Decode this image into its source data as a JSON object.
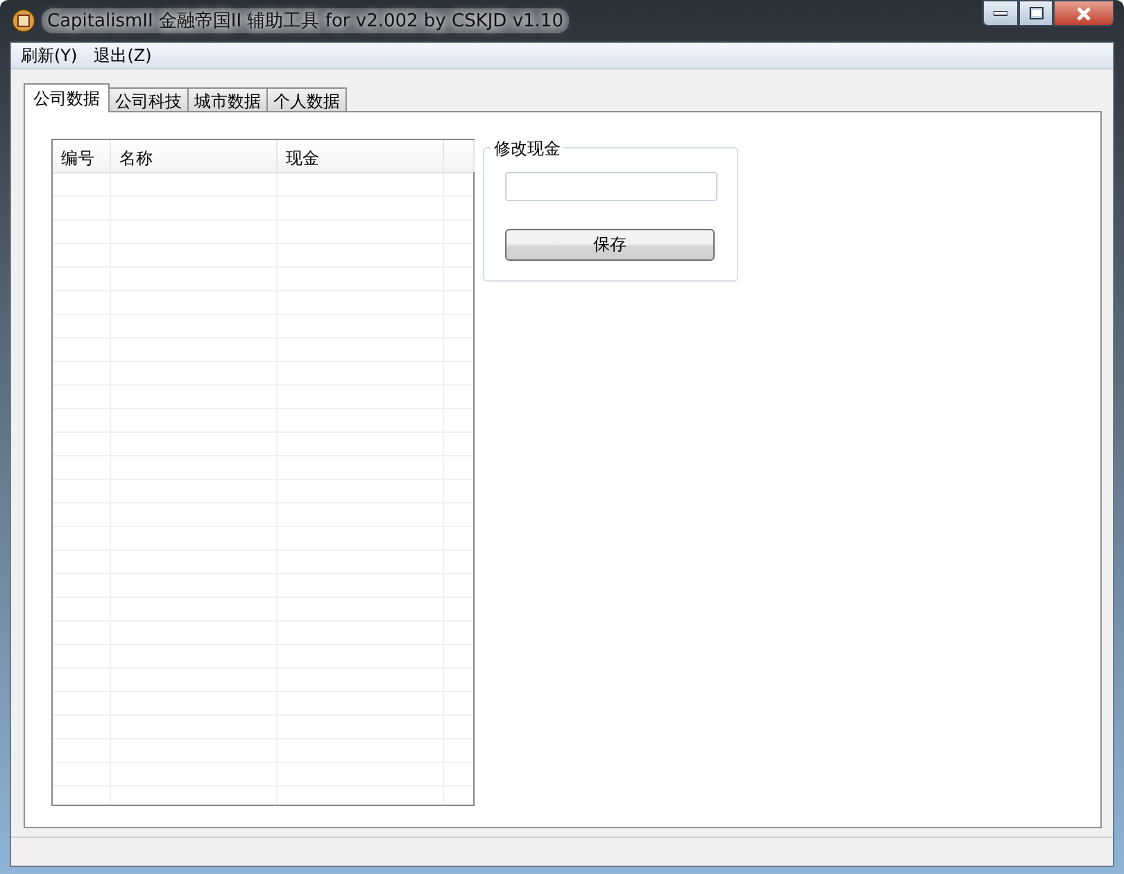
{
  "window": {
    "title": "CapitalismII 金融帝国II 辅助工具 for v2.002 by CSKJD v1.10"
  },
  "menu": [
    {
      "label": "刷新(Y)"
    },
    {
      "label": "退出(Z)"
    }
  ],
  "tabs": [
    {
      "label": "公司数据",
      "selected": true
    },
    {
      "label": "公司科技",
      "selected": false
    },
    {
      "label": "城市数据",
      "selected": false
    },
    {
      "label": "个人数据",
      "selected": false
    }
  ],
  "table": {
    "columns": [
      "编号",
      "名称",
      "现金"
    ]
  },
  "cash_group": {
    "title": "修改现金",
    "button": "保存"
  }
}
